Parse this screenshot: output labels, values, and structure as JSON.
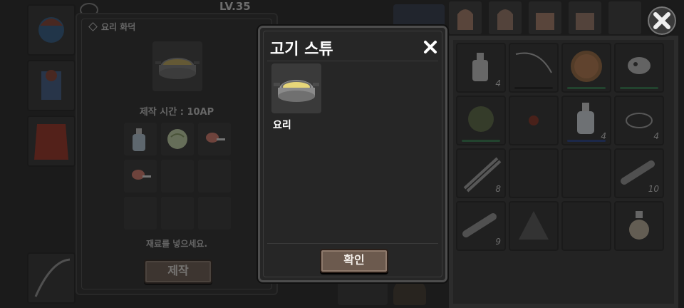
{
  "background": {
    "level_label": "LV.35"
  },
  "cooking_panel": {
    "title": "요리 화덕",
    "craft_time": "제작 시간 : 10AP",
    "hint": "재료를 넣으세요.",
    "craft_button": "제작",
    "ingredients": [
      "water-bottle",
      "cabbage",
      "meat",
      "meat"
    ]
  },
  "inventory": {
    "counts": [
      "4",
      "",
      "",
      "",
      "",
      "",
      "4",
      "4",
      "8",
      "",
      "",
      "10",
      "9",
      "",
      "",
      ""
    ],
    "bar_colors": [
      "",
      "#1a1a1a",
      "#2c7a4a",
      "#2c7a4a",
      "#2c7a4a",
      "",
      "#1f3a8a",
      "",
      "",
      "",
      "",
      "",
      "",
      "",
      "",
      ""
    ]
  },
  "dialog": {
    "title": "고기 스튜",
    "item_label": "요리",
    "confirm_button": "확인",
    "close_icon": "close-icon"
  },
  "colors": {
    "dialog_bg": "#262626",
    "button_bg": "#6c5a4e",
    "inventory_frame": "#444444"
  }
}
